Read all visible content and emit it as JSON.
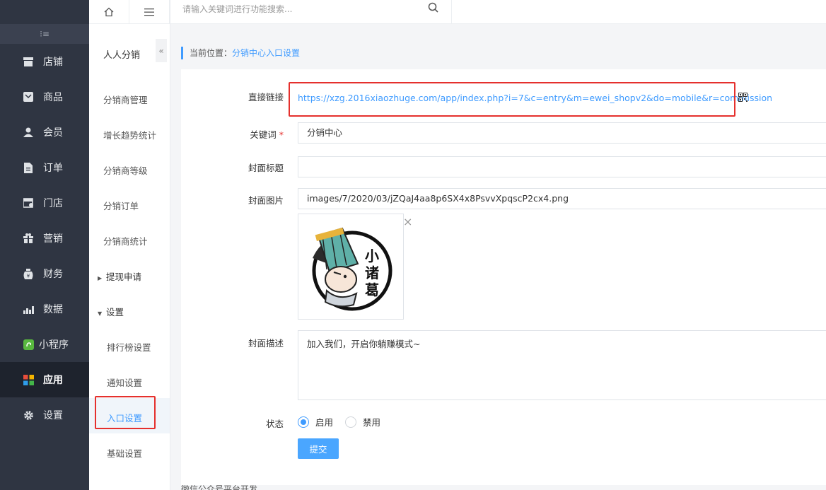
{
  "sidebar": {
    "collapse_glyph": "⁝≡",
    "items": [
      {
        "label": "店铺",
        "icon": "store-icon"
      },
      {
        "label": "商品",
        "icon": "goods-icon"
      },
      {
        "label": "会员",
        "icon": "member-icon"
      },
      {
        "label": "订单",
        "icon": "order-icon"
      },
      {
        "label": "门店",
        "icon": "shop-icon"
      },
      {
        "label": "营销",
        "icon": "gift-icon"
      },
      {
        "label": "财务",
        "icon": "money-bag-icon"
      },
      {
        "label": "数据",
        "icon": "chart-icon"
      },
      {
        "label": "小程序",
        "icon": "miniapp-icon"
      },
      {
        "label": "应用",
        "icon": "apps-icon",
        "active": true
      },
      {
        "label": "设置",
        "icon": "gear-icon"
      }
    ]
  },
  "subnav": {
    "title": "人人分销",
    "fold_glyph": "«",
    "items": [
      "分销商管理",
      "增长趋势统计",
      "分销商等级",
      "分销订单",
      "分销商统计"
    ],
    "group_withdraw": "提现申请",
    "group_settings": "设置",
    "settings_children": [
      "排行榜设置",
      "通知设置",
      "入口设置",
      "基础设置"
    ]
  },
  "topbar": {
    "search_placeholder": "请输入关键词进行功能搜索..."
  },
  "breadcrumb": {
    "prefix": "当前位置：",
    "current": "分销中心入口设置"
  },
  "form": {
    "direct_link_label": "直接链接",
    "direct_link_url": "https://xzg.2016xiaozhuge.com/app/index.php?i=7&c=entry&m=ewei_shopv2&do=mobile&r=commission",
    "keyword_label": "关键词",
    "keyword_required": "*",
    "keyword_value": "分销中心",
    "cover_title_label": "封面标题",
    "cover_title_value": "",
    "cover_image_label": "封面图片",
    "cover_image_value": "images/7/2020/03/jZQaJ4aa8p6SX4x8PsvvXpqscP2cx4.png",
    "cover_image_logo_text": "小诸葛",
    "remove_glyph": "×",
    "cover_desc_label": "封面描述",
    "cover_desc_value": "加入我们，开启你躺赚模式~",
    "status_label": "状态",
    "status_on": "启用",
    "status_off": "禁用",
    "submit_label": "提交"
  },
  "footer_text": "微信公众号平台开发",
  "colors": {
    "sidebar_bg": "#2f3542",
    "accent": "#3f9bff",
    "highlight_box": "#e5302d"
  }
}
